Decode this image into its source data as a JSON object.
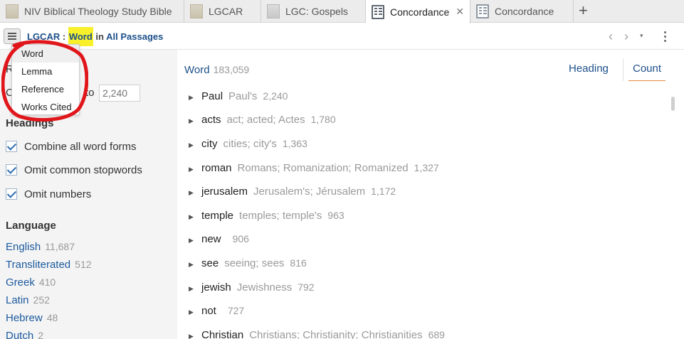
{
  "tabs": [
    {
      "label": "NIV Biblical Theology Study Bible",
      "icon": "book-cover-icon"
    },
    {
      "label": "LGCAR",
      "icon": "book-cover-icon"
    },
    {
      "label": "LGC: Gospels",
      "icon": "book-cover-icon"
    },
    {
      "label": "Concordance",
      "icon": "concordance-icon",
      "active": true,
      "close": "✕"
    },
    {
      "label": "Concordance",
      "icon": "concordance-icon"
    }
  ],
  "new_tab": "+",
  "toolbar": {
    "resource": "LGCAR",
    "separator": ":",
    "type": "Word",
    "in_text": "in",
    "scope": "All Passages",
    "prev": "‹",
    "next": "›",
    "dropdown": "▾"
  },
  "dropdown_menu": [
    "Word",
    "Lemma",
    "Reference",
    "Works Cited"
  ],
  "left_panel": {
    "partial_r": "R",
    "partial_c": "C",
    "partial_to": "to",
    "range_max": "2,240",
    "headings_title": "Headings",
    "checks": [
      "Combine all word forms",
      "Omit common stopwords",
      "Omit numbers"
    ],
    "language_title": "Language",
    "languages": [
      {
        "name": "English",
        "count": "11,687"
      },
      {
        "name": "Transliterated",
        "count": "512"
      },
      {
        "name": "Greek",
        "count": "410"
      },
      {
        "name": "Latin",
        "count": "252"
      },
      {
        "name": "Hebrew",
        "count": "48"
      },
      {
        "name": "Dutch",
        "count": "2"
      }
    ]
  },
  "main": {
    "title": "Word",
    "total": "183,059",
    "sort_heading": "Heading",
    "sort_count": "Count",
    "words": [
      {
        "word": "Paul",
        "forms": "Paul's",
        "count": "2,240"
      },
      {
        "word": "acts",
        "forms": "act; acted; Actes",
        "count": "1,780"
      },
      {
        "word": "city",
        "forms": "cities; city's",
        "count": "1,363"
      },
      {
        "word": "roman",
        "forms": "Romans; Romanization; Romanized",
        "count": "1,327"
      },
      {
        "word": "jerusalem",
        "forms": "Jerusalem's; Jérusalem",
        "count": "1,172"
      },
      {
        "word": "temple",
        "forms": "temples; temple's",
        "count": "963"
      },
      {
        "word": "new",
        "forms": "",
        "count": "906"
      },
      {
        "word": "see",
        "forms": "seeing; sees",
        "count": "816"
      },
      {
        "word": "jewish",
        "forms": "Jewishness",
        "count": "792"
      },
      {
        "word": "not",
        "forms": "",
        "count": "727"
      },
      {
        "word": "Christian",
        "forms": "Christians; Christianity; Christianities",
        "count": "689"
      }
    ]
  },
  "colors": {
    "link": "#1c4f8a",
    "highlight": "#f7f02a",
    "annotation": "#e0161b",
    "count_underline": "#e08c3c"
  }
}
